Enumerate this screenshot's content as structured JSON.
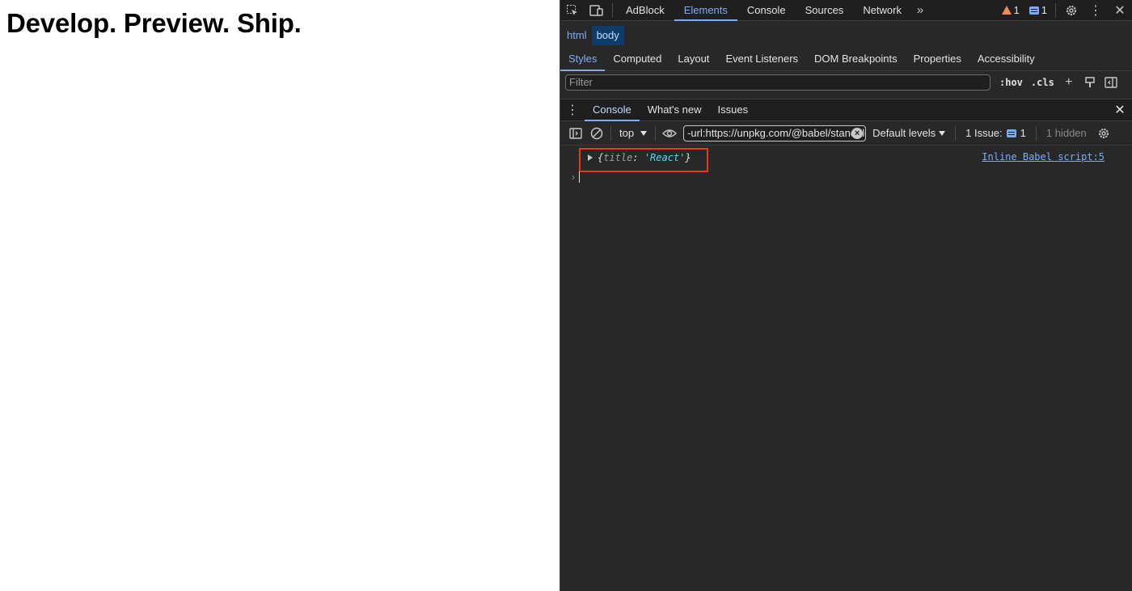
{
  "page": {
    "heading": "Develop. Preview. Ship."
  },
  "devtools": {
    "main_tabs": [
      "AdBlock",
      "Elements",
      "Console",
      "Sources",
      "Network"
    ],
    "active_main_tab": "Elements",
    "warnings_count": "1",
    "messages_count": "1",
    "breadcrumbs": [
      "html",
      "body"
    ],
    "styles_tabs": [
      "Styles",
      "Computed",
      "Layout",
      "Event Listeners",
      "DOM Breakpoints",
      "Properties",
      "Accessibility"
    ],
    "styles_filter_placeholder": "Filter",
    "hov_label": ":hov",
    "cls_label": ".cls",
    "drawer_tabs": [
      "Console",
      "What's new",
      "Issues"
    ],
    "console_toolbar": {
      "context": "top",
      "filter_value": "-url:https://unpkg.com/@babel/standalone",
      "levels_label": "Default levels",
      "issues_label": "1 Issue:",
      "issues_count": "1",
      "hidden_label": "1 hidden"
    },
    "console_log": {
      "open_brace": "{",
      "key": "title",
      "colon": ": ",
      "value": "'React'",
      "close_brace": "}",
      "source": "Inline Babel script:5"
    },
    "colors": {
      "accent": "#7cacf8",
      "highlight_box": "#e8391d",
      "warning": "#f28b54",
      "string": "#5cd5fb"
    }
  }
}
